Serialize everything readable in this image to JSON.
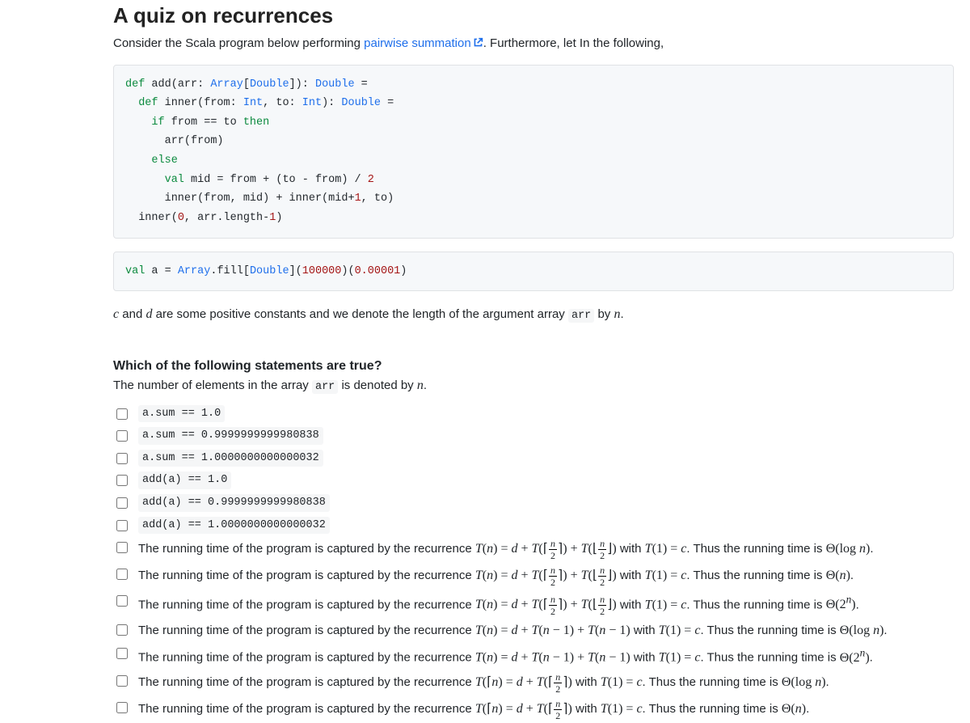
{
  "title": "A quiz on recurrences",
  "intro_prefix": "Consider the Scala program below performing ",
  "intro_link": "pairwise summation",
  "intro_suffix": ". Furthermore, let In the following,",
  "code1": {
    "l1a": "def",
    "l1b": " add(arr: ",
    "l1c": "Array",
    "l1d": "[",
    "l1e": "Double",
    "l1f": "]): ",
    "l1g": "Double",
    "l1h": " =",
    "l2a": "def",
    "l2b": " inner(from: ",
    "l2c": "Int",
    "l2d": ", to: ",
    "l2e": "Int",
    "l2f": "): ",
    "l2g": "Double",
    "l2h": " =",
    "l3a": "if",
    "l3b": " from == to ",
    "l3c": "then",
    "l4": "arr(from)",
    "l5": "else",
    "l6a": "val",
    "l6b": " mid = from + (to - from) / ",
    "l6c": "2",
    "l7a": "inner(from, mid) + inner(mid+",
    "l7b": "1",
    "l7c": ", to)",
    "l8a": "inner(",
    "l8b": "0",
    "l8c": ", arr.length-",
    "l8d": "1",
    "l8e": ")"
  },
  "code2": {
    "a": "val",
    "b": " a = ",
    "c": "Array",
    "d": ".fill[",
    "e": "Double",
    "f": "](",
    "g": "100000",
    "h": ")(",
    "i": "0.00001",
    "j": ")"
  },
  "constants_text": {
    "c": "c",
    "and": " and ",
    "d": "d",
    "rest_a": " are some positive constants and we denote the length of the argument array ",
    "arr": "arr",
    "rest_b": " by ",
    "n": "n",
    "dot": "."
  },
  "question": "Which of the following statements are true?",
  "subq_a": "The number of elements in the array ",
  "subq_arr": "arr",
  "subq_b": " is denoted by ",
  "subq_n": "n",
  "subq_dot": ".",
  "opts_code": [
    "a.sum == 1.0",
    "a.sum == 0.9999999999980838",
    "a.sum == 1.0000000000000032",
    "add(a) == 1.0",
    "add(a) == 0.9999999999980838",
    "add(a) == 1.0000000000000032"
  ],
  "recur_prefix": "The running time of the program is captured by the recurrence ",
  "recur_with": " with ",
  "recur_thus": ". Thus the running time is ",
  "recur_dot": ".",
  "recurrences": [
    {
      "type": "half2",
      "base": "T(1) = c",
      "theta": "Θ(log n)"
    },
    {
      "type": "half2",
      "base": "T(1) = c",
      "theta": "Θ(n)"
    },
    {
      "type": "half2",
      "base": "T(1) = c",
      "theta": "Θ(2ⁿ)"
    },
    {
      "type": "nm1x2",
      "base": "T(1) = c",
      "theta": "Θ(log n)"
    },
    {
      "type": "nm1x2",
      "base": "T(1) = c",
      "theta": "Θ(2ⁿ)"
    },
    {
      "type": "half1",
      "base": "T(1) = c",
      "theta": "Θ(log n)"
    },
    {
      "type": "half1",
      "base": "T(1) = c",
      "theta": "Θ(n)"
    }
  ]
}
